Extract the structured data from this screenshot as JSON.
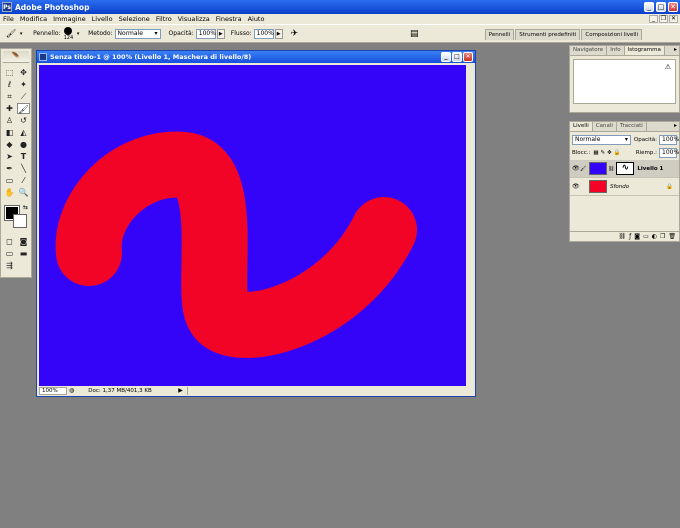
{
  "app": {
    "title": "Adobe Photoshop"
  },
  "menu": [
    "File",
    "Modifica",
    "Immagine",
    "Livello",
    "Selezione",
    "Filtro",
    "Visualizza",
    "Finestra",
    "Aiuto"
  ],
  "options": {
    "brush_label": "Pennello:",
    "brush_size": "124",
    "mode_label": "Metodo:",
    "mode_value": "Normale",
    "opacity_label": "Opacità:",
    "opacity_value": "100%",
    "flow_label": "Flusso:",
    "flow_value": "100%"
  },
  "panel_wells": [
    "Pennelli",
    "Strumenti predefiniti",
    "Composizioni livelli"
  ],
  "document": {
    "title": "Senza titolo-1 @ 100% (Livello 1, Maschera di livello/8)",
    "zoom": "100%",
    "info": "Doc: 1,37 MB/401,3 KB",
    "background_color": "#3404f9",
    "stroke_color": "#f10426"
  },
  "navigator": {
    "tabs": [
      "Navigatore",
      "Info",
      "Istogramma"
    ],
    "active_tab": 2,
    "warning": "⚠"
  },
  "layers": {
    "tabs": [
      "Livelli",
      "Canali",
      "Tracciati"
    ],
    "blend_mode": "Normale",
    "opacity_label": "Opacità:",
    "opacity_value": "100%",
    "lock_label": "Blocc.:",
    "fill_label": "Riemp.:",
    "fill_value": "100%",
    "items": [
      {
        "name": "Livello 1",
        "color": "#3404f9",
        "selected": true
      },
      {
        "name": "Sfondo",
        "color": "#f10426",
        "selected": false
      }
    ]
  }
}
